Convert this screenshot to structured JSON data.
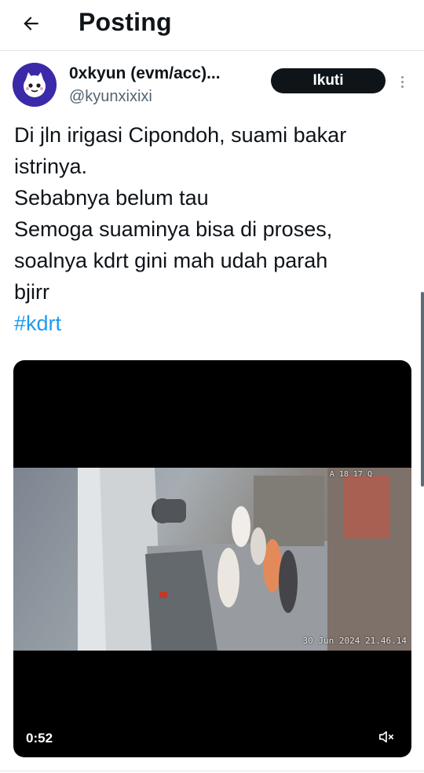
{
  "header": {
    "title": "Posting",
    "back_icon": "arrow-left-icon"
  },
  "author": {
    "display_name": "0xkyun (evm/acc)...",
    "handle": "@kyunxixixi",
    "avatar_icon": "purple-cartoon-avatar",
    "follow_label": "Ikuti"
  },
  "tweet": {
    "lines": [
      "Di jln irigasi Cipondoh, suami bakar",
      "istrinya.",
      "Sebabnya belum tau",
      "Semoga suaminya bisa di proses,",
      "soalnya kdrt gini mah udah parah",
      "bjirr"
    ],
    "hashtag": "#kdrt"
  },
  "video": {
    "cctv_top_text": "A 18 17 Q",
    "cctv_timestamp": "30 Jun 2024 21.46.14",
    "duration": "0:52",
    "mute_icon": "speaker-muted-icon"
  },
  "colors": {
    "text": "#0f1419",
    "secondary": "#536471",
    "link": "#1d9bf0",
    "follow_bg": "#0f1419",
    "avatar_bg": "#3b2aa8"
  }
}
